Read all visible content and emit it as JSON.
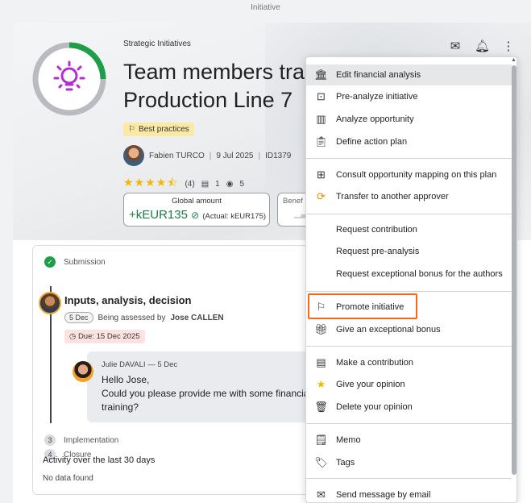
{
  "window": {
    "title": "Initiative"
  },
  "initiative": {
    "category": "Strategic Initiatives",
    "title_line1": "Team members train",
    "title_line2": "Production Line 7",
    "badge": "Best practices",
    "author": "Fabien TURCO",
    "date": "9 Jul 2025",
    "id": "ID1379",
    "rating_count": "(4)",
    "comments_count": "1",
    "views_count": "5",
    "global_amount_label": "Global amount",
    "global_amount_value": "+kEUR135",
    "global_amount_actual": "(Actual: kEUR175)",
    "benefit_label": "Benef"
  },
  "workflow": {
    "step1": {
      "label": "Submission"
    },
    "step2": {
      "title": "Inputs, analysis, decision",
      "days": "5 Dec",
      "assessed_prefix": "Being assessed by",
      "assessor": "Jose CALLEN",
      "due": "Due: 15 Dec 2025"
    },
    "comment": {
      "author": "Julie DAVALI",
      "date": "5 Dec",
      "line1": "Hello Jose,",
      "line2": "Could you please provide me with some financial de",
      "line3": "training?"
    },
    "step3": {
      "num": "3",
      "label": "Implementation"
    },
    "step4": {
      "num": "4",
      "label": "Closure"
    },
    "activity_title": "Activity over the last 30 days",
    "activity_empty": "No data found"
  },
  "menu": {
    "items": [
      {
        "label": "Edit financial analysis",
        "icon": "bank-icon"
      },
      {
        "label": "Pre-analyze initiative",
        "icon": "chart-small-icon"
      },
      {
        "label": "Analyze opportunity",
        "icon": "bar-chart-icon"
      },
      {
        "label": "Define action plan",
        "icon": "clipboard-icon"
      },
      {
        "label": "Consult opportunity mapping on this plan",
        "icon": "grid-icon"
      },
      {
        "label": "Transfer to another approver",
        "icon": "transfer-icon"
      },
      {
        "label": "Request contribution"
      },
      {
        "label": "Request pre-analysis"
      },
      {
        "label": "Request exceptional bonus for the authors"
      },
      {
        "label": "Promote initiative",
        "icon": "flag-icon"
      },
      {
        "label": "Give an exceptional bonus",
        "icon": "gift-icon"
      },
      {
        "label": "Make a contribution",
        "icon": "message-icon"
      },
      {
        "label": "Give your opinion",
        "icon": "star-icon"
      },
      {
        "label": "Delete your opinion",
        "icon": "trash-icon"
      },
      {
        "label": "Memo",
        "icon": "memo-icon"
      },
      {
        "label": "Tags",
        "icon": "tag-icon"
      },
      {
        "label": "Send message by email",
        "icon": "mail-icon"
      }
    ]
  },
  "colors": {
    "accent": "#1e9e49",
    "ring": "#b8bbc0",
    "bulb": "#b12ecf",
    "highlight": "#f06c1b"
  }
}
